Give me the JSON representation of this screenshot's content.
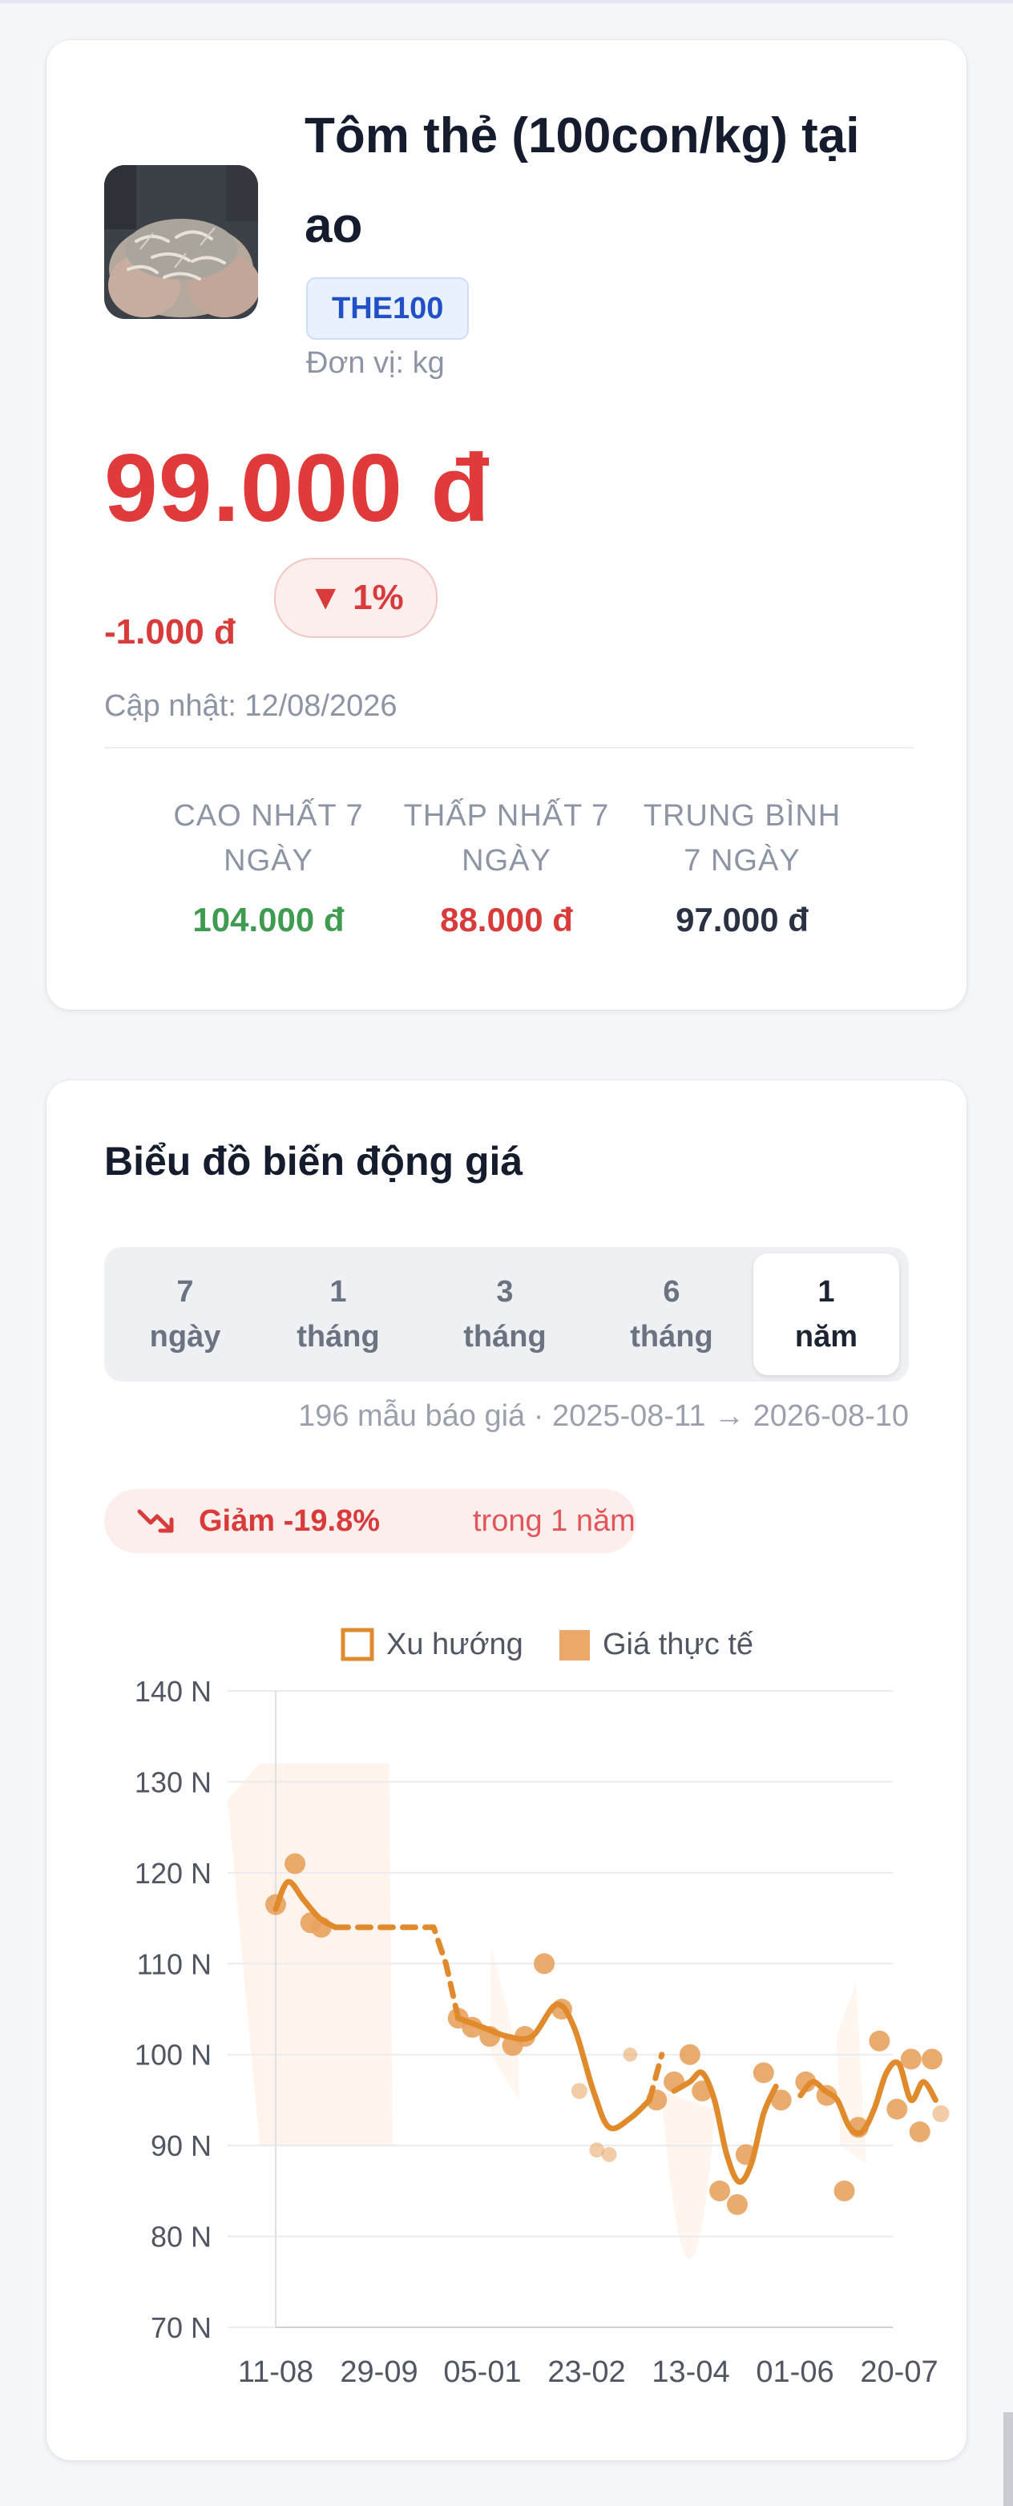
{
  "product": {
    "title": "Tôm thẻ (100con/kg) tại ao",
    "code": "THE100",
    "unit_label": "Đơn vị: kg",
    "price": "99.000 đ",
    "change_amount": "-1.000 đ",
    "change_percent": "▼ 1%",
    "updated": "Cập nhật: 12/08/2026",
    "thumbnail_icon": "shrimp-photo"
  },
  "stats": [
    {
      "label": "CAO NHẤT 7 NGÀY",
      "value": "104.000 đ",
      "color": "#3e9b4f"
    },
    {
      "label": "THẤP NHẤT 7 NGÀY",
      "value": "88.000 đ",
      "color": "#d93a3a"
    },
    {
      "label": "TRUNG BÌNH 7 NGÀY",
      "value": "97.000 đ",
      "color": "#2a3142"
    }
  ],
  "chart_section": {
    "title": "Biểu đồ biến động giá",
    "ranges": [
      {
        "label": "7 ngày",
        "active": false
      },
      {
        "label": "1 tháng",
        "active": false
      },
      {
        "label": "3 tháng",
        "active": false
      },
      {
        "label": "6 tháng",
        "active": false
      },
      {
        "label": "1 năm",
        "active": true
      }
    ],
    "sample_info": "196 mẫu báo giá · 2025-08-11 → 2026-08-10",
    "trend_main": "Giảm -19.8%",
    "trend_sub": "trong 1 năm",
    "trend_icon": "trending-down-icon"
  },
  "colors": {
    "accent": "#e08a2c",
    "down": "#d93a3a",
    "up": "#3e9b4f"
  },
  "chart_data": {
    "type": "line",
    "legend": [
      "Xu hướng",
      "Giá thực tế"
    ],
    "legend_position": "top-center",
    "ylim": [
      70000,
      140000
    ],
    "y_ticks": [
      "70 N",
      "80 N",
      "90 N",
      "100 N",
      "110 N",
      "120 N",
      "130 N",
      "140 N"
    ],
    "x_ticks": [
      "11-08",
      "29-09",
      "05-01",
      "23-02",
      "13-04",
      "01-06",
      "20-07"
    ],
    "grid": true,
    "series": [
      {
        "name": "Xu hướng",
        "segments": [
          {
            "dashed": false,
            "points": [
              [
                "2025-08-11",
                116000
              ],
              [
                "2025-08-18",
                119000
              ],
              [
                "2025-08-27",
                117000
              ],
              [
                "2025-09-05",
                115000
              ],
              [
                "2025-09-14",
                114000
              ]
            ]
          },
          {
            "dashed": true,
            "points": [
              [
                "2025-09-14",
                114000
              ],
              [
                "2025-11-09",
                114000
              ],
              [
                "2025-11-16",
                110000
              ],
              [
                "2025-11-23",
                104000
              ]
            ]
          },
          {
            "dashed": false,
            "points": [
              [
                "2025-11-23",
                104000
              ],
              [
                "2025-12-07",
                103000
              ],
              [
                "2025-12-21",
                102000
              ],
              [
                "2026-01-04",
                102000
              ],
              [
                "2026-01-18",
                105500
              ],
              [
                "2026-01-28",
                103000
              ],
              [
                "2026-02-08",
                96000
              ],
              [
                "2026-02-17",
                92000
              ],
              [
                "2026-03-01",
                93000
              ],
              [
                "2026-03-12",
                95000
              ]
            ]
          },
          {
            "dashed": true,
            "points": [
              [
                "2026-03-12",
                95000
              ],
              [
                "2026-03-19",
                100000
              ]
            ]
          },
          {
            "dashed": false,
            "points": [
              [
                "2026-03-26",
                96000
              ],
              [
                "2026-04-04",
                97000
              ],
              [
                "2026-04-11",
                98000
              ],
              [
                "2026-04-18",
                95000
              ],
              [
                "2026-04-25",
                89000
              ],
              [
                "2026-05-02",
                86000
              ],
              [
                "2026-05-09",
                88000
              ],
              [
                "2026-05-16",
                93500
              ],
              [
                "2026-05-23",
                96500
              ]
            ]
          },
          {
            "dashed": false,
            "points": [
              [
                "2026-06-06",
                95500
              ],
              [
                "2026-06-13",
                97000
              ],
              [
                "2026-06-20",
                96000
              ],
              [
                "2026-06-27",
                95000
              ],
              [
                "2026-07-04",
                92000
              ],
              [
                "2026-07-11",
                91500
              ],
              [
                "2026-07-18",
                94000
              ],
              [
                "2026-07-25",
                98000
              ],
              [
                "2026-08-01",
                99000
              ],
              [
                "2026-08-08",
                95000
              ],
              [
                "2026-08-15",
                97000
              ],
              [
                "2026-08-22",
                95000
              ]
            ]
          }
        ]
      },
      {
        "name": "Giá thực tế",
        "points": [
          [
            "2025-08-11",
            116500
          ],
          [
            "2025-08-22",
            121000
          ],
          [
            "2025-08-31",
            114500
          ],
          [
            "2025-09-06",
            114000
          ],
          [
            "2025-11-23",
            104000
          ],
          [
            "2025-12-01",
            103000
          ],
          [
            "2025-12-11",
            102000
          ],
          [
            "2025-12-24",
            101000
          ],
          [
            "2025-12-31",
            102000
          ],
          [
            "2026-01-11",
            110000
          ],
          [
            "2026-01-21",
            105000
          ],
          [
            "2026-01-31",
            96000
          ],
          [
            "2026-02-10",
            89500
          ],
          [
            "2026-02-17",
            89000
          ],
          [
            "2026-03-01",
            100000
          ],
          [
            "2026-03-16",
            95000
          ],
          [
            "2026-03-26",
            97000
          ],
          [
            "2026-04-04",
            100000
          ],
          [
            "2026-04-11",
            96000
          ],
          [
            "2026-04-21",
            85000
          ],
          [
            "2026-05-01",
            83500
          ],
          [
            "2026-05-06",
            89000
          ],
          [
            "2026-05-16",
            98000
          ],
          [
            "2026-05-26",
            95000
          ],
          [
            "2026-06-09",
            97000
          ],
          [
            "2026-06-21",
            95500
          ],
          [
            "2026-07-01",
            85000
          ],
          [
            "2026-07-09",
            92000
          ],
          [
            "2026-07-21",
            101500
          ],
          [
            "2026-07-31",
            94000
          ],
          [
            "2026-08-08",
            99500
          ],
          [
            "2026-08-13",
            91500
          ],
          [
            "2026-08-20",
            99500
          ],
          [
            "2026-08-25",
            93500
          ]
        ],
        "point_sizes": [
          1,
          1,
          1,
          1,
          1,
          1,
          1,
          1,
          1,
          1,
          1,
          0.5,
          0.4,
          0.4,
          0.3,
          1,
          1,
          1,
          1,
          1,
          1,
          1,
          1,
          1,
          1,
          1,
          1,
          1,
          1,
          1,
          1,
          1,
          1,
          0.6
        ]
      }
    ]
  }
}
